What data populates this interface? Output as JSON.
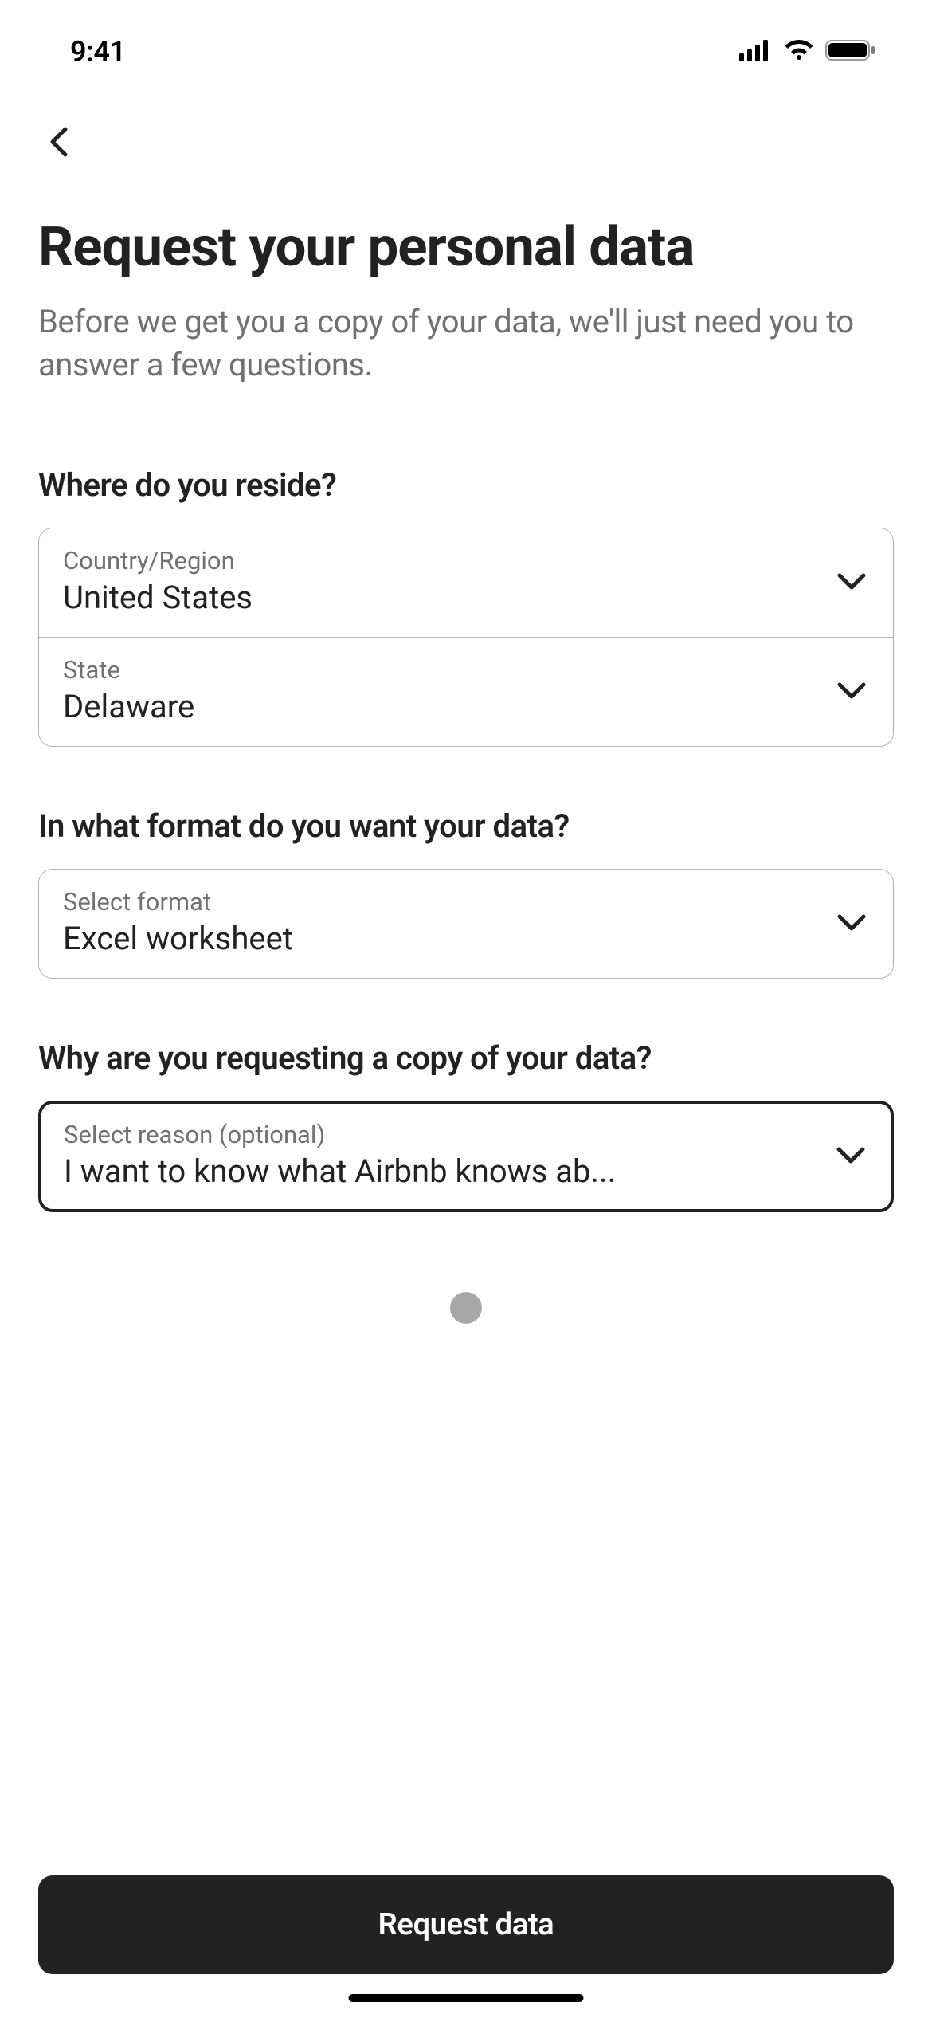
{
  "status": {
    "time": "9:41"
  },
  "header": {
    "title": "Request your personal data",
    "subtitle": "Before we get you a copy of your data, we'll just need you to answer a few questions."
  },
  "sections": {
    "residence": {
      "heading": "Where do you reside?",
      "country_label": "Country/Region",
      "country_value": "United States",
      "state_label": "State",
      "state_value": "Delaware"
    },
    "format": {
      "heading": "In what format do you want your data?",
      "format_label": "Select format",
      "format_value": "Excel worksheet"
    },
    "reason": {
      "heading": "Why are you requesting a copy of your data?",
      "reason_label": "Select reason (optional)",
      "reason_value": "I want to know what Airbnb knows ab..."
    }
  },
  "footer": {
    "submit_label": "Request data"
  }
}
